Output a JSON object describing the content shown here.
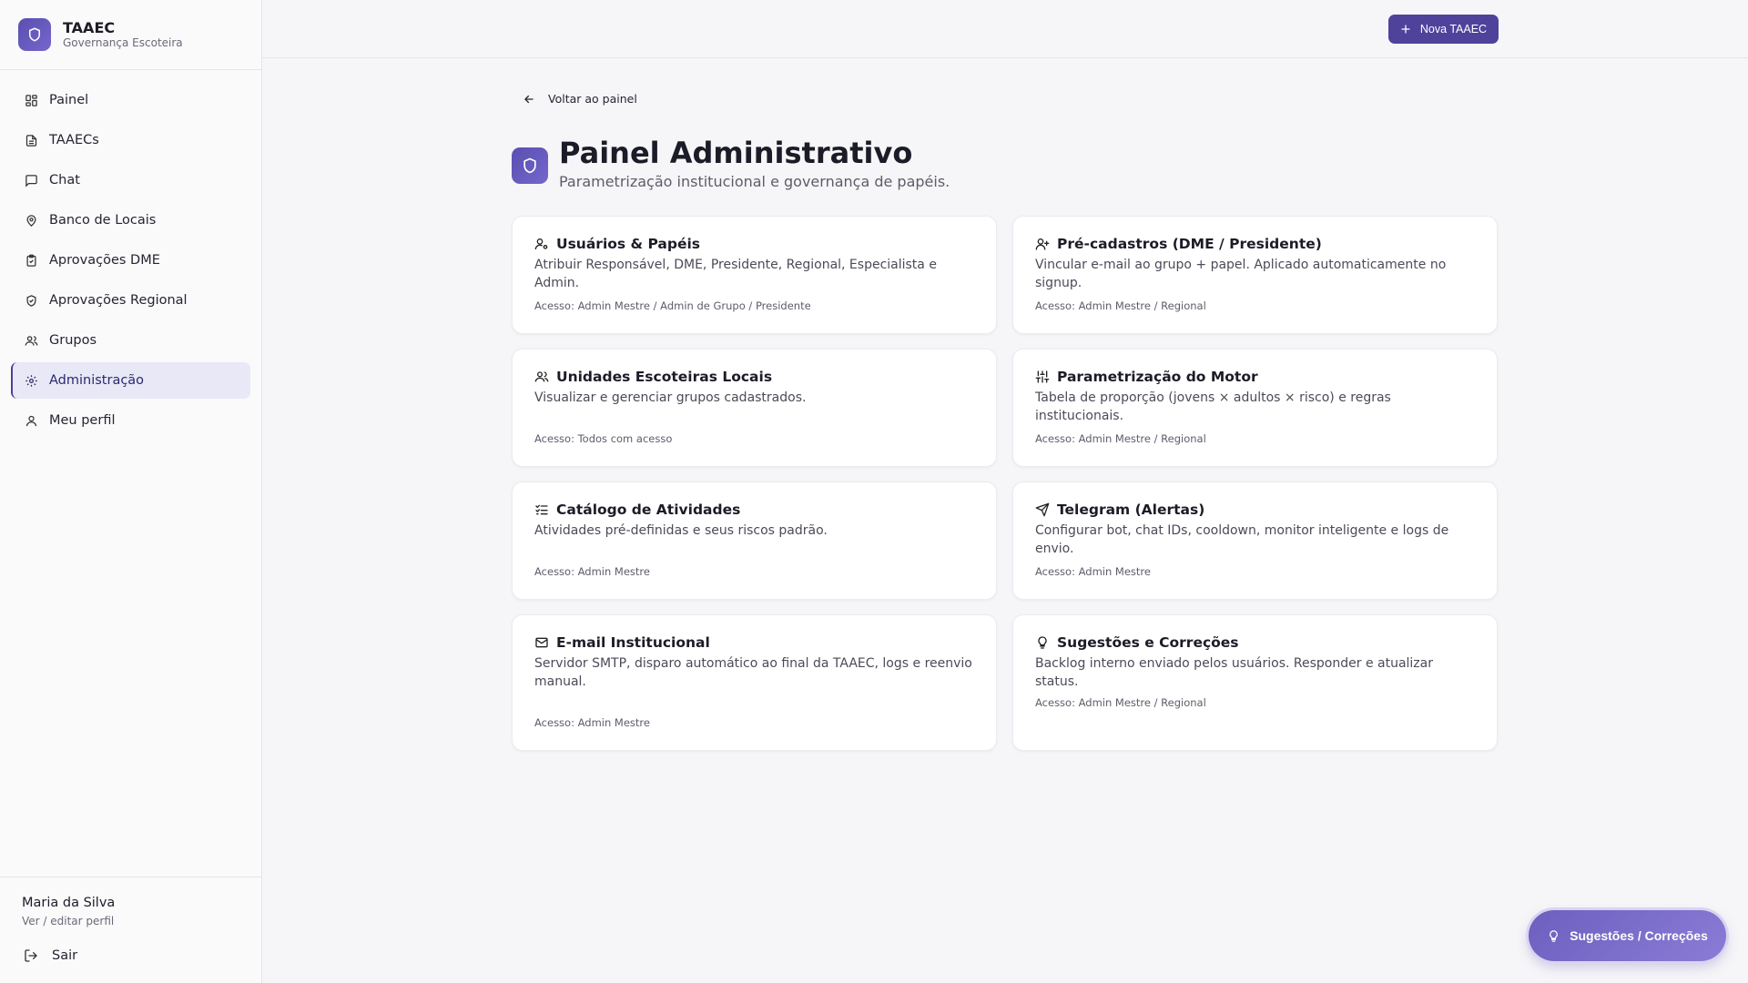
{
  "brand": {
    "title": "TAAEC",
    "subtitle": "Governança Escoteira",
    "icon": "shield-icon"
  },
  "sidebar": {
    "items": [
      {
        "label": "Painel",
        "icon": "dashboard-icon"
      },
      {
        "label": "TAAECs",
        "icon": "document-icon"
      },
      {
        "label": "Chat",
        "icon": "chat-icon"
      },
      {
        "label": "Banco de Locais",
        "icon": "map-pin-icon"
      },
      {
        "label": "Aprovações DME",
        "icon": "clipboard-check-icon"
      },
      {
        "label": "Aprovações Regional",
        "icon": "shield-check-icon"
      },
      {
        "label": "Grupos",
        "icon": "users-icon"
      },
      {
        "label": "Administração",
        "icon": "gear-icon",
        "active": true
      },
      {
        "label": "Meu perfil",
        "icon": "user-icon"
      }
    ]
  },
  "user": {
    "name": "Maria da Silva",
    "sub": "Ver / editar perfil",
    "logout": "Sair"
  },
  "topbar": {
    "new_button": "Nova TAAEC"
  },
  "main": {
    "back": "Voltar ao painel",
    "title": "Painel Administrativo",
    "subtitle": "Parametrização institucional e governança de papéis."
  },
  "cards": [
    {
      "title": "Usuários & Papéis",
      "icon": "user-gear-icon",
      "desc": "Atribuir Responsável, DME, Presidente, Regional, Especialista e Admin.",
      "access": "Acesso: Admin Mestre / Admin de Grupo / Presidente"
    },
    {
      "title": "Pré-cadastros (DME / Presidente)",
      "icon": "user-plus-icon",
      "desc": "Vincular e-mail ao grupo + papel. Aplicado automaticamente no signup.",
      "access": "Acesso: Admin Mestre / Regional"
    },
    {
      "title": "Unidades Escoteiras Locais",
      "icon": "users-icon",
      "desc": "Visualizar e gerenciar grupos cadastrados.",
      "access": "Acesso: Todos com acesso"
    },
    {
      "title": "Parametrização do Motor",
      "icon": "sliders-icon",
      "desc": "Tabela de proporção (jovens × adultos × risco) e regras institucionais.",
      "access": "Acesso: Admin Mestre / Regional"
    },
    {
      "title": "Catálogo de Atividades",
      "icon": "checklist-icon",
      "desc": "Atividades pré-definidas e seus riscos padrão.",
      "access": "Acesso: Admin Mestre"
    },
    {
      "title": "Telegram (Alertas)",
      "icon": "send-icon",
      "desc": "Configurar bot, chat IDs, cooldown, monitor inteligente e logs de envio.",
      "access": "Acesso: Admin Mestre"
    },
    {
      "title": "E-mail Institucional",
      "icon": "mail-icon",
      "desc": "Servidor SMTP, disparo automático ao final da TAAEC, logs e reenvio manual.",
      "access": "Acesso: Admin Mestre"
    },
    {
      "title": "Sugestões e Correções",
      "icon": "lightbulb-icon",
      "desc": "Backlog interno enviado pelos usuários. Responder e atualizar status.",
      "access": "Acesso: Admin Mestre / Regional"
    }
  ],
  "fab": {
    "label": "Sugestões / Correções",
    "icon": "lightbulb-icon"
  },
  "colors": {
    "accent": "#4e429b",
    "active_bg": "#e8e8f6"
  }
}
